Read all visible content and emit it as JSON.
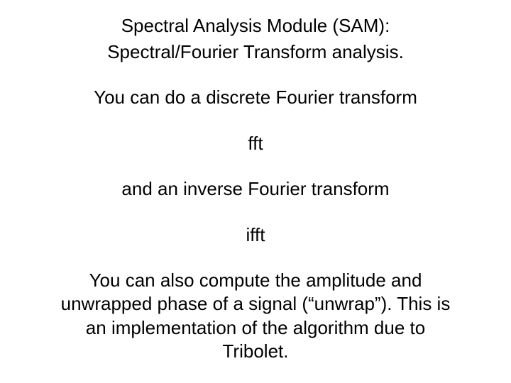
{
  "title": {
    "line1": "Spectral Analysis Module (SAM):",
    "line2": "Spectral/Fourier Transform analysis."
  },
  "body": {
    "intro_line": "You can do a discrete Fourier transform",
    "cmd1": "fft",
    "inverse_line": "and an inverse Fourier transform",
    "cmd2": "ifft",
    "para_line1": "You can also compute the amplitude and",
    "para_line2": "unwrapped phase of a signal (“unwrap”). This is",
    "para_line3": "an implementation of the algorithm due to",
    "para_line4": "Tribolet."
  }
}
